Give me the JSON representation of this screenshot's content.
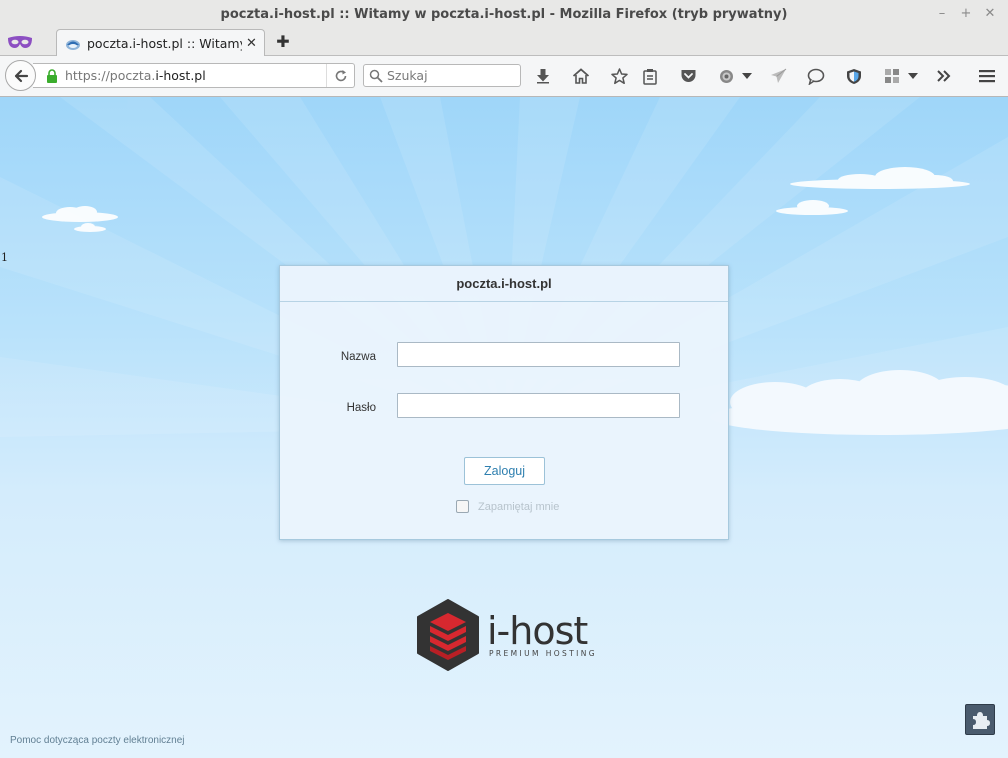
{
  "window": {
    "title": "poczta.i-host.pl :: Witamy w poczta.i-host.pl - Mozilla Firefox (tryb prywatny)",
    "controls": {
      "minimize": "–",
      "maximize": "+",
      "close": "✕"
    }
  },
  "tabs": [
    {
      "label": "poczta.i-host.pl :: Witamy ...",
      "close": "✕"
    }
  ],
  "newtab_label": "✚",
  "navbar": {
    "url_prefix": "https://poczta.",
    "url_host": "i-host.pl",
    "search_placeholder": "Szukaj"
  },
  "page": {
    "side_number": "1",
    "login": {
      "header": "poczta.i-host.pl",
      "username_label": "Nazwa",
      "password_label": "Hasło",
      "submit_label": "Zaloguj",
      "remember_label": "Zapamiętaj mnie"
    },
    "logo": {
      "name": "i-host",
      "tagline": "PREMIUM HOSTING"
    },
    "help_link": "Pomoc dotycząca poczty elektronicznej"
  },
  "colors": {
    "sky_top": "#9fd6f9",
    "sky_bottom": "#e3f3fd",
    "login_accent": "#2e7faf",
    "logo_red": "#d7282f",
    "logo_dark": "#333333"
  }
}
